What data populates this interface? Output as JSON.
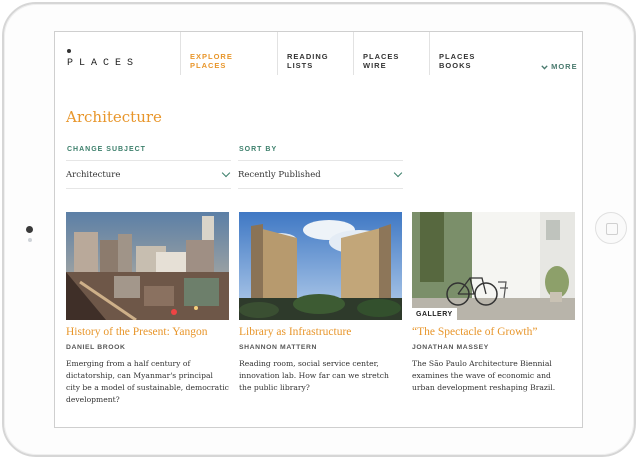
{
  "app": {
    "logo": "PLACES"
  },
  "nav": {
    "items": [
      {
        "line1": "EXPLORE",
        "line2": "PLACES",
        "active": true
      },
      {
        "line1": "READING",
        "line2": "LISTS",
        "active": false
      },
      {
        "line1": "PLACES",
        "line2": "WIRE",
        "active": false
      },
      {
        "line1": "PLACES",
        "line2": "BOOKS",
        "active": false
      }
    ],
    "more": "MORE"
  },
  "page": {
    "title": "Architecture"
  },
  "filters": {
    "subject": {
      "label": "CHANGE SUBJECT",
      "value": "Architecture"
    },
    "sort": {
      "label": "SORT BY",
      "value": "Recently Published"
    }
  },
  "articles": [
    {
      "title": "History of the Present: Yangon",
      "author": "DANIEL BROOK",
      "description": "Emerging from a half century of dictatorship, can Myanmar's principal city be a model of sustainable, democratic development?",
      "image": "yangon-cityscape"
    },
    {
      "title": "Library as Infrastructure",
      "author": "SHANNON MATTERN",
      "description": "Reading room, social service center, innovation lab. How far can we stretch the public library?",
      "image": "library-towers"
    },
    {
      "title": "“The Spectacle of Growth”",
      "author": "JONATHAN MASSEY",
      "description": "The São Paulo Architecture Biennial examines the wave of economic and urban development reshaping Brazil.",
      "image": "white-wall-bicycle",
      "badge": "GALLERY"
    }
  ],
  "colors": {
    "accent": "#e8962b",
    "teal": "#3c7f6b"
  }
}
